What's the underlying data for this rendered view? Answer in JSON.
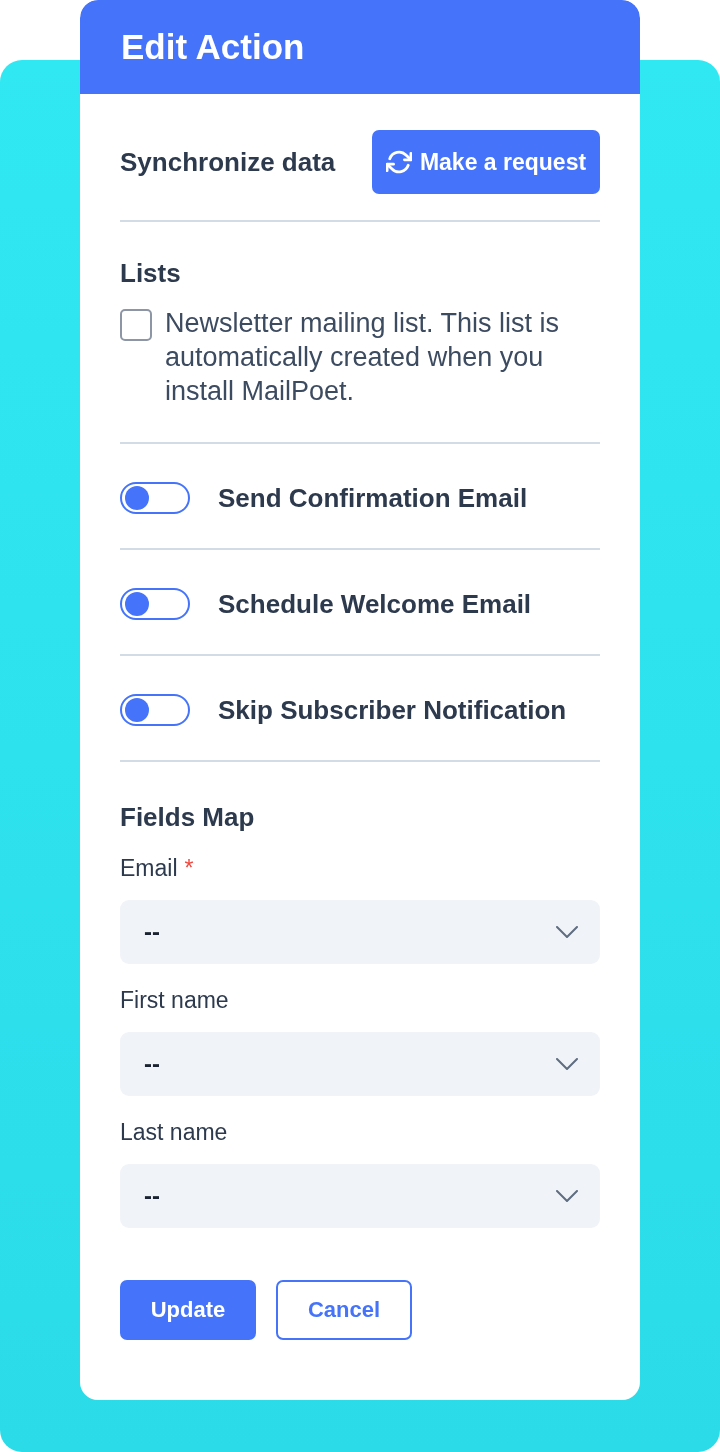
{
  "dialog": {
    "title": "Edit Action"
  },
  "sync": {
    "label": "Synchronize data",
    "button": "Make a request"
  },
  "lists": {
    "heading": "Lists",
    "items": [
      {
        "label": "Newsletter mailing list. This list is automatically created when you install MailPoet.",
        "checked": false
      }
    ]
  },
  "options": [
    {
      "label": "Send Confirmation Email",
      "on": false
    },
    {
      "label": "Schedule Welcome Email",
      "on": false
    },
    {
      "label": "Skip Subscriber Notification",
      "on": false
    }
  ],
  "fields_map": {
    "heading": "Fields Map",
    "fields": [
      {
        "label": "Email",
        "required_mark": "*",
        "value": "--"
      },
      {
        "label": "First name",
        "value": "--"
      },
      {
        "label": "Last name",
        "value": "--"
      }
    ]
  },
  "actions": [
    {
      "label": "Update",
      "kind": "primary"
    },
    {
      "label": "Cancel",
      "kind": "secondary"
    }
  ]
}
